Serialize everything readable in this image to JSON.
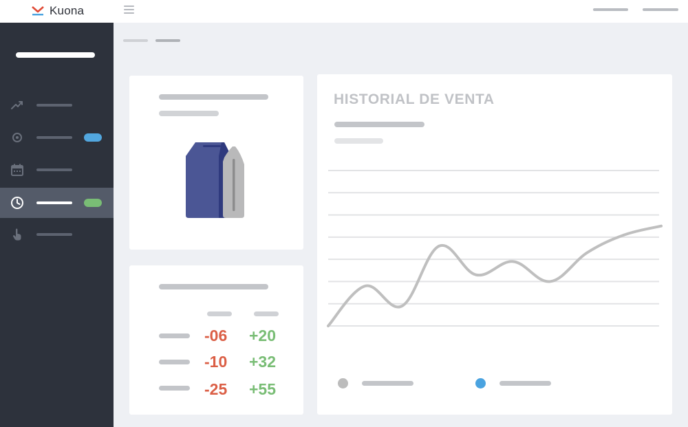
{
  "app": {
    "brand": "Kuona"
  },
  "colors": {
    "sidebar_bg": "#2d323c",
    "sidebar_active": "#545b69",
    "badge_blue": "#52a7df",
    "badge_green": "#79bd75",
    "negative": "#db5f46",
    "positive": "#79bd75",
    "product_blue": "#4b5695",
    "chart_line": "#bfbfbf",
    "legend_grey": "#bcbcbc",
    "legend_blue": "#4aa3e0"
  },
  "sidebar": {
    "items": [
      {
        "icon": "trend-icon",
        "active": false,
        "badge": null
      },
      {
        "icon": "target-icon",
        "active": false,
        "badge": "blue"
      },
      {
        "icon": "calendar-icon",
        "active": false,
        "badge": null
      },
      {
        "icon": "clock-icon",
        "active": true,
        "badge": "green"
      },
      {
        "icon": "hand-pointer-icon",
        "active": false,
        "badge": null
      }
    ]
  },
  "product_card": {
    "icon": "product-bag-icon"
  },
  "stats_card": {
    "rows": [
      {
        "negative": "-06",
        "positive": "+20"
      },
      {
        "negative": "-10",
        "positive": "+32"
      },
      {
        "negative": "-25",
        "positive": "+55"
      }
    ]
  },
  "chart_card": {
    "title": "HISTORIAL DE VENTA"
  },
  "chart_data": {
    "type": "line",
    "title": "HISTORIAL DE VENTA",
    "xlabel": "",
    "ylabel": "",
    "grid": true,
    "legend": "bottom",
    "series": [
      {
        "values": [
          0.0,
          1.8,
          0.9,
          3.6,
          2.3,
          2.9,
          2.0,
          3.3,
          4.1,
          4.5
        ]
      }
    ],
    "ylim": [
      0,
      7
    ]
  }
}
